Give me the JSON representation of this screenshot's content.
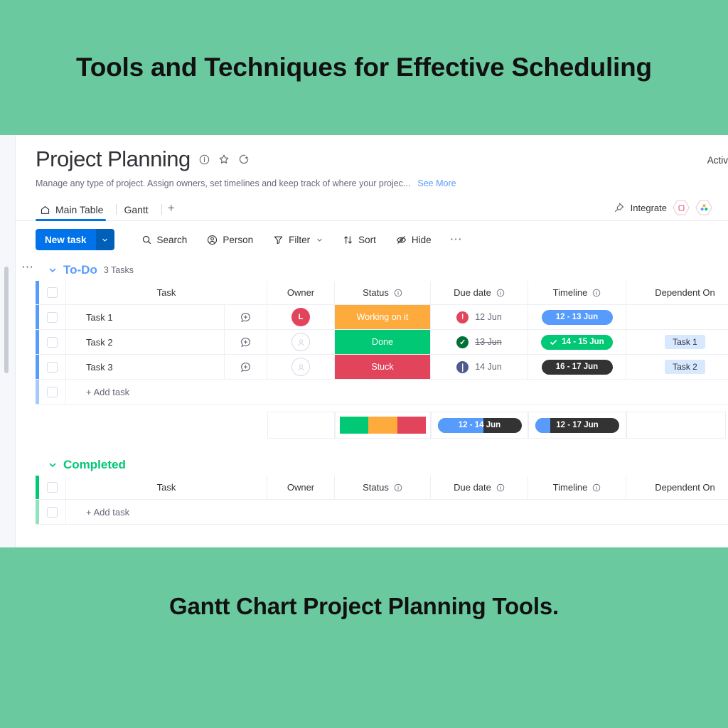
{
  "banner": {
    "top_title": "Tools and Techniques for Effective Scheduling",
    "bottom_title": "Gantt Chart  Project Planning Tools.",
    "background_color": "#6BC9A0"
  },
  "board": {
    "title": "Project Planning",
    "description": "Manage any type of project. Assign owners, set timelines and keep track of where your projec...",
    "see_more": "See More",
    "activity_label": "Activ",
    "icons": [
      "info-icon",
      "star-icon",
      "add-reaction-icon"
    ]
  },
  "tabs": [
    {
      "label": "Main Table",
      "icon": "home-icon",
      "active": true
    },
    {
      "label": "Gantt",
      "icon": "",
      "active": false
    }
  ],
  "tab_add_label": "+",
  "integrate": {
    "label": "Integrate",
    "icon": "plug-icon"
  },
  "toolbar": {
    "new_task_label": "New task",
    "new_task_caret": "⌄",
    "items": [
      {
        "label": "Search",
        "icon": "search-icon",
        "caret": false
      },
      {
        "label": "Person",
        "icon": "person-icon",
        "caret": false
      },
      {
        "label": "Filter",
        "icon": "filter-icon",
        "caret": true
      },
      {
        "label": "Sort",
        "icon": "sort-icon",
        "caret": false
      },
      {
        "label": "Hide",
        "icon": "eye-off-icon",
        "caret": false
      }
    ],
    "more_label": "⋯"
  },
  "columns": [
    "Task",
    "Owner",
    "Status",
    "Due date",
    "Timeline",
    "Dependent On"
  ],
  "add_task_label": "+ Add task",
  "groups": [
    {
      "name": "To-Do",
      "count_label": "3 Tasks",
      "color": "#579bfc",
      "rows": [
        {
          "task": "Task 1",
          "owner_initial": "L",
          "owner_filled": true,
          "status": "Working on it",
          "status_color": "#fdab3d",
          "due_date": "12 Jun",
          "due_strike": false,
          "due_dot_color": "#e2445c",
          "due_dot_glyph": "!",
          "timeline": "12 - 13 Jun",
          "timeline_color": "#579bfc",
          "timeline_check": false,
          "dependent_on": ""
        },
        {
          "task": "Task 2",
          "owner_initial": "",
          "owner_filled": false,
          "status": "Done",
          "status_color": "#00c875",
          "due_date": "13 Jun",
          "due_strike": true,
          "due_dot_color": "#007038",
          "due_dot_glyph": "✓",
          "timeline": "14 - 15 Jun",
          "timeline_color": "#00c875",
          "timeline_check": true,
          "dependent_on": "Task 1"
        },
        {
          "task": "Task 3",
          "owner_initial": "",
          "owner_filled": false,
          "status": "Stuck",
          "status_color": "#e2445c",
          "due_date": "14 Jun",
          "due_strike": false,
          "due_dot_color": "#4f5a8f",
          "due_dot_glyph": "❘",
          "timeline": "16 - 17 Jun",
          "timeline_color": "#333333",
          "timeline_check": false,
          "dependent_on": "Task 2"
        }
      ],
      "summary": {
        "status_segments": [
          {
            "color": "#00c875",
            "pct": 33
          },
          {
            "color": "#fdab3d",
            "pct": 34
          },
          {
            "color": "#e2445c",
            "pct": 33
          }
        ],
        "due_progress": {
          "label": "12 - 14 Jun",
          "fill_color": "#579bfc",
          "rest_color": "#333333",
          "fill_pct": 55
        },
        "timeline_progress": {
          "label": "12 - 17 Jun",
          "fill_color": "#579bfc",
          "rest_color": "#333333",
          "fill_pct": 18
        }
      }
    },
    {
      "name": "Completed",
      "count_label": "",
      "color": "#00c875",
      "rows": []
    }
  ]
}
